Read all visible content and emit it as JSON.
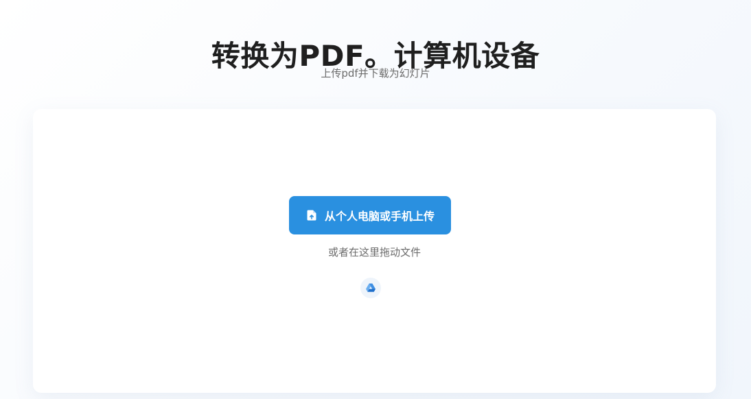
{
  "header": {
    "title": "转换为PDF。计算机设备",
    "subtitle": "上传pdf并下载为幻灯片"
  },
  "upload": {
    "button_label": "从个人电脑或手机上传",
    "button_icon": "file-upload-icon",
    "drag_hint": "或者在这里拖动文件",
    "cloud_icon": "google-drive-icon"
  },
  "colors": {
    "accent": "#2a90e0",
    "title": "#1f1f1f",
    "muted": "#6b6b6b",
    "card": "#ffffff"
  }
}
